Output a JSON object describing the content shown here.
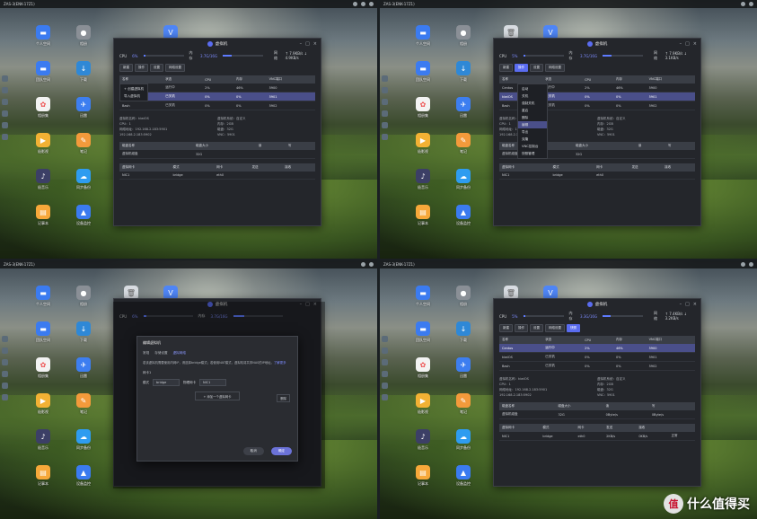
{
  "topbar": {
    "title": "ZAS-3(ENK-17Z1)"
  },
  "desktop_apps": [
    {
      "label": "个人空间",
      "icon": "folder-icon",
      "color": "#3b7bf0"
    },
    {
      "label": "相册",
      "icon": "camera-icon",
      "color": "#8a8f96"
    },
    {
      "label": "",
      "icon": "trash-icon",
      "color": "#d9dde2"
    },
    {
      "label": "",
      "icon": "vpn-icon",
      "color": "#4f86f7"
    },
    {
      "label": "团队空间",
      "icon": "team-folder-icon",
      "color": "#3b7bf0"
    },
    {
      "label": "下载",
      "icon": "download-icon",
      "color": "#2f88d6"
    },
    {
      "label": "相册集",
      "icon": "photos-icon",
      "color": "#f3f3f3"
    },
    {
      "label": "迅雷",
      "icon": "thunder-icon",
      "color": "#3d7ef0"
    },
    {
      "label": "极影视",
      "icon": "video-icon",
      "color": "#f2b134"
    },
    {
      "label": "笔记",
      "icon": "notes-icon",
      "color": "#f39a3b"
    },
    {
      "label": "极音乐",
      "icon": "music-icon",
      "color": "#3c3f66"
    },
    {
      "label": "同步备份",
      "icon": "cloud-backup-icon",
      "color": "#2e9cf0"
    },
    {
      "label": "记事本",
      "icon": "notepad-icon",
      "color": "#f7a83a"
    },
    {
      "label": "设备监控",
      "icon": "monitor-chart-icon",
      "color": "#3b7bf0"
    },
    {
      "label": "远程访问",
      "icon": "remote-icon",
      "color": "#3b7bf0"
    }
  ],
  "vm_window": {
    "title": "虚拟机",
    "cpu_label": "CPU",
    "mem_label": "内存",
    "net_label": "网络",
    "panes": [
      {
        "cpu": "6%",
        "mem": "3.7G/16G",
        "net": "↑ 7.9KB/s ↓ 4.9KB/s"
      },
      {
        "cpu": "5%",
        "mem": "3.7G/16G",
        "net": "↑ 7.9KB/s ↓ 3.1KB/s"
      },
      {
        "cpu": "6%",
        "mem": "3.7G/16G",
        "net": ""
      },
      {
        "cpu": "5%",
        "mem": "3.3G/16G",
        "net": "↑ 7.4KB/s ↓ 3.2KB/s"
      }
    ],
    "toolbar": {
      "new": "新建",
      "action": "操作",
      "manage": "设置",
      "network": "网络设置",
      "snapshot": "快照"
    },
    "table": {
      "headers": [
        "名称",
        "状态",
        "CPU",
        "内存",
        "VNC端口"
      ],
      "rows": [
        [
          "Centos",
          "运行中",
          "2%",
          "46%",
          "5900"
        ],
        [
          "kiwiOS",
          "已关机",
          "0%",
          "0%",
          "5901"
        ],
        [
          "Bash",
          "已关机",
          "0%",
          "0%",
          "5902"
        ]
      ]
    },
    "detail": {
      "left": [
        "虚拟机名称：kiwiOS",
        "CPU：1",
        "网络地址：192.168.2.183:5901",
        "192.168.2.183:5902"
      ],
      "right": [
        "虚拟机系统：自定义",
        "内存：2GB",
        "磁盘：32G",
        "VNC：5901"
      ]
    },
    "disk_table": {
      "headers": [
        "磁盘名称",
        "磁盘大小",
        "读",
        "写"
      ],
      "rows": [
        [
          "虚拟机磁盘",
          "32G",
          "",
          ""
        ]
      ]
    },
    "nic_table": {
      "headers": [
        "虚拟网卡",
        "模式",
        "网卡",
        "发送",
        "接收",
        ""
      ],
      "rows": [
        [
          "NIC1",
          "bridge",
          "eth0",
          "",
          "",
          ""
        ]
      ]
    },
    "pane4_disk_row": [
      "虚拟机磁盘",
      "32G",
      "0Byte/s",
      "0Byte/s"
    ],
    "pane4_nic_row": [
      "NIC1",
      "bridge",
      "eth0",
      "2KB/s",
      "0KB/s",
      "正常"
    ]
  },
  "add_menu": {
    "items": [
      "启动",
      "关机",
      "强制关机",
      "重启",
      "删除",
      "编辑",
      "导出",
      "克隆",
      "VNC控制台",
      "快照管理"
    ]
  },
  "left_menu": {
    "items": [
      "+ 创建虚拟机",
      "导入虚拟机"
    ]
  },
  "modal": {
    "title": "编辑虚拟机",
    "tabs": [
      "常规",
      "存储设置",
      "虚拟网络"
    ],
    "note": "若该虚拟机需要使用内网IP，请选择bridge模式；若使用NAT模式，虚拟机将共享NAS的IP地址。",
    "note_link": "了解更多",
    "nic_label": "网卡1",
    "mode_label": "模式",
    "mode_value": "bridge",
    "nic_select_label": "物理网卡",
    "nic_select_value": "NIC1",
    "delete": "删除",
    "add": "+ 添加一个虚拟网卡",
    "cancel": "取消",
    "confirm": "确定"
  },
  "brand": {
    "circle": "值",
    "text": "什么值得买"
  }
}
